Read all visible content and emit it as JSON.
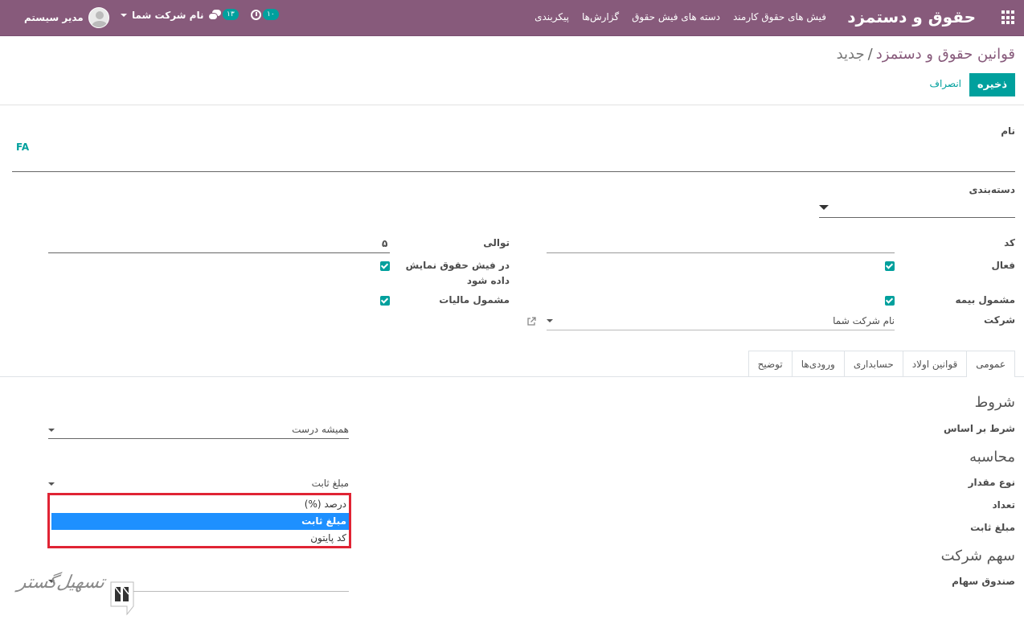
{
  "navbar": {
    "app_title": "حقوق و دستمزد",
    "menu": [
      "فیش های حقوق کارمند",
      "دسته های فیش حقوق",
      "گزارش‌ها",
      "پیکربندی"
    ],
    "activity_count": "۱۰",
    "message_count": "۱۳",
    "company_name": "نام شرکت شما",
    "user_name": "مدیر سیستم"
  },
  "breadcrumb": {
    "parent": "قوانین حقوق و دستمزد",
    "separator": "/",
    "current": "جدید"
  },
  "buttons": {
    "save": "ذخیره",
    "discard": "انصراف"
  },
  "form": {
    "name_label": "نام",
    "name_value": "FA",
    "category_label": "دسته‌بندی",
    "category_value": "",
    "code_label": "کد",
    "code_value": "",
    "sequence_label": "توالی",
    "sequence_value": "۵",
    "active_label": "فعال",
    "active_checked": true,
    "appears_on_payslip_label": "در فیش حقوق نمایش",
    "appears_on_payslip_label_2": "داده شود",
    "appears_on_payslip_checked": true,
    "insurance_label": "مشمول بیمه",
    "insurance_checked": true,
    "tax_label": "مشمول مالیات",
    "tax_checked": true,
    "company_label": "شرکت",
    "company_value": "نام شرکت شما"
  },
  "tabs": [
    "عمومی",
    "قوانین اولاد",
    "حسابداری",
    "ورودی‌ها",
    "توضیح"
  ],
  "active_tab": "عمومی",
  "general": {
    "conditions_title": "شروط",
    "condition_based_label": "شرط بر اساس",
    "condition_based_value": "همیشه درست",
    "computation_title": "محاسبه",
    "amount_type_label": "نوع مقدار",
    "amount_type_value": "مبلغ ثابت",
    "quantity_label": "تعداد",
    "fixed_amount_label": "مبلغ ثابت",
    "company_contribution_title": "سهم شرکت",
    "contribution_register_label": "صندوق سهام",
    "amount_type_options": [
      "درصد (%)",
      "مبلغ ثابت",
      "کد پایتون"
    ],
    "amount_type_selected": "مبلغ ثابت"
  },
  "watermark": {
    "text": "تسهیل‌گستر"
  },
  "colors": {
    "navbar": "#875a7b",
    "accent": "#00a09d",
    "highlight_border": "#e02434",
    "selected_option": "#1e90ff"
  }
}
